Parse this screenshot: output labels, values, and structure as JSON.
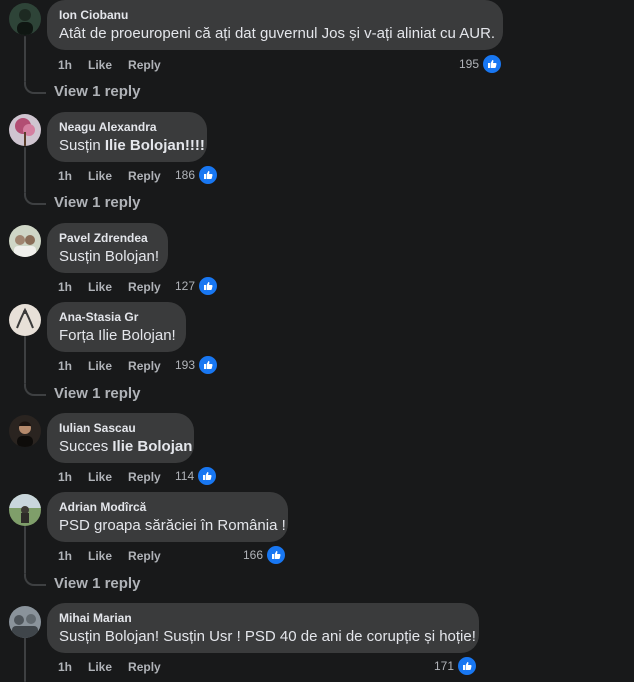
{
  "colors": {
    "background": "#18191a",
    "bubble": "#3a3b3c",
    "text": "#e4e6eb",
    "muted": "#b0b3b8",
    "like_blue": "#1877f2"
  },
  "labels": {
    "time": "1h",
    "like": "Like",
    "reply": "Reply",
    "view_reply": "View 1 reply"
  },
  "comments": [
    {
      "author": "Ion Ciobanu",
      "text": "Atât de proeuropeni că ați dat guvernul Jos și v-ați aliniat cu AUR.",
      "likes": "195"
    },
    {
      "author": "Neagu Alexandra",
      "text_plain": "Susțin ",
      "text_bold": "Ilie Bolojan!!!!",
      "likes": "186"
    },
    {
      "author": "Pavel Zdrendea",
      "text": "Susțin Bolojan!",
      "likes": "127"
    },
    {
      "author": "Ana-Stasia Gr",
      "text": "Forța Ilie Bolojan!",
      "likes": "193"
    },
    {
      "author": "Iulian Sascau",
      "text_plain": "Succes ",
      "text_bold": "Ilie Bolojan",
      "likes": "114"
    },
    {
      "author": "Adrian Modîrcă",
      "text": "PSD groapa sărăciei în România !",
      "likes": "166"
    },
    {
      "author": "Mihai Marian",
      "text": "Susțin Bolojan! Susțin Usr ! PSD 40 de ani de corupție și hoție!",
      "likes": "171"
    }
  ]
}
